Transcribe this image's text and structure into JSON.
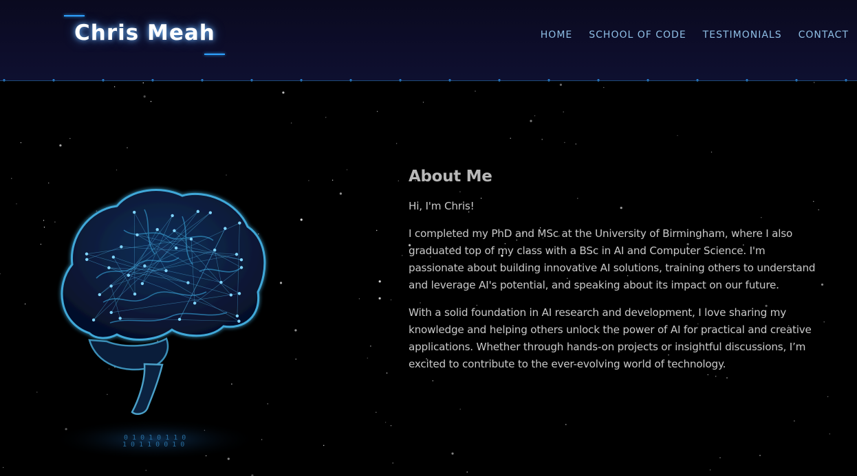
{
  "header": {
    "logo": "Chris Meah",
    "nav": [
      {
        "label": "HOME"
      },
      {
        "label": "SCHOOL OF CODE"
      },
      {
        "label": "TESTIMONIALS"
      },
      {
        "label": "CONTACT"
      }
    ]
  },
  "about": {
    "heading": "About Me",
    "paragraphs": [
      "Hi, I'm Chris!",
      "I completed my PhD and MSc at the University of Birmingham, where I also graduated top of my class with a BSc in AI and Computer Science. I'm passionate about building innovative AI solutions, training others to understand and leverage AI's potential, and speaking about its impact on our future.",
      "With a solid foundation in AI research and development, I love sharing my knowledge and helping others unlock the power of AI for practical and creative applications. Whether through hands-on projects or insightful discussions, I’m excited to contribute to the ever-evolving world of technology."
    ]
  },
  "colors": {
    "accent": "#2fa3ff",
    "nav_text": "#8fbfe6",
    "body_text": "#c9c9c9",
    "heading_text": "#b8b8b8",
    "header_bg": "#0d0d2a"
  }
}
